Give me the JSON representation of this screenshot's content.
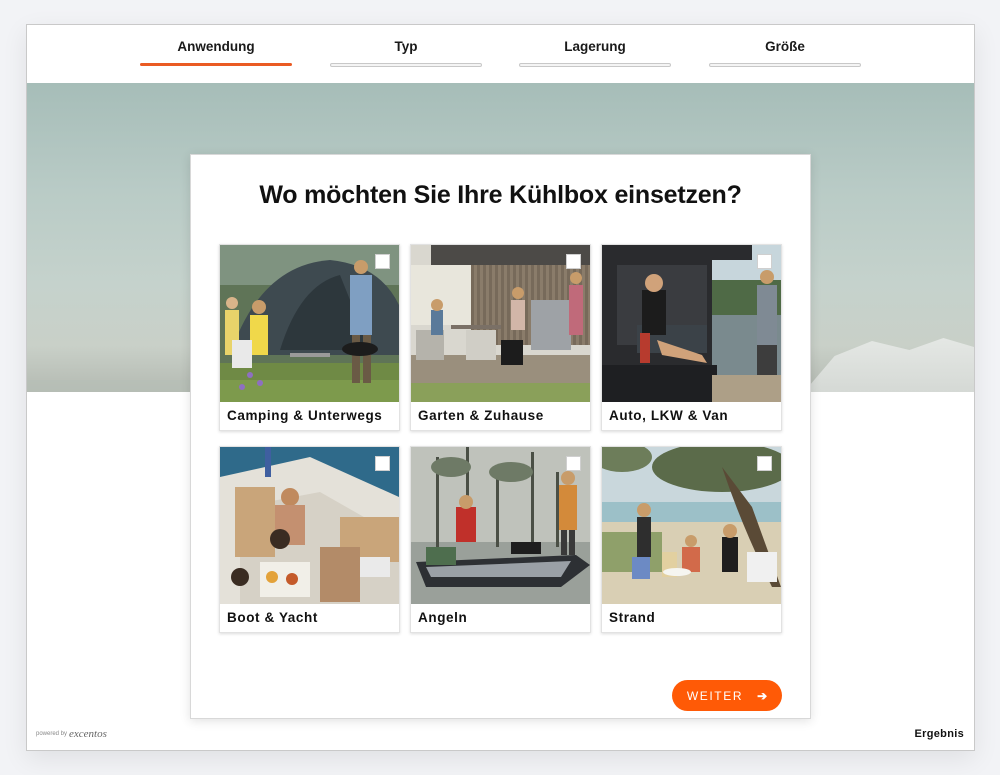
{
  "steps": [
    {
      "label": "Anwendung",
      "active": true
    },
    {
      "label": "Typ",
      "active": false
    },
    {
      "label": "Lagerung",
      "active": false
    },
    {
      "label": "Größe",
      "active": false
    }
  ],
  "question": "Wo möchten Sie Ihre Kühlbox einsetzen?",
  "options": [
    {
      "label": "Camping & Unterwegs",
      "image": "camping-photo"
    },
    {
      "label": "Garten & Zuhause",
      "image": "garden-photo"
    },
    {
      "label": "Auto, LKW & Van",
      "image": "car-photo"
    },
    {
      "label": "Boot & Yacht",
      "image": "boat-photo"
    },
    {
      "label": "Angeln",
      "image": "fishing-photo"
    },
    {
      "label": "Strand",
      "image": "beach-photo"
    }
  ],
  "next_button": {
    "label": "WEITER",
    "icon": "arrow-right-icon"
  },
  "footer": {
    "powered_by": "powered by",
    "brand": "excentos",
    "result_link": "Ergebnis"
  },
  "colors": {
    "accent": "#ea5b23",
    "button": "#ff5a06"
  }
}
